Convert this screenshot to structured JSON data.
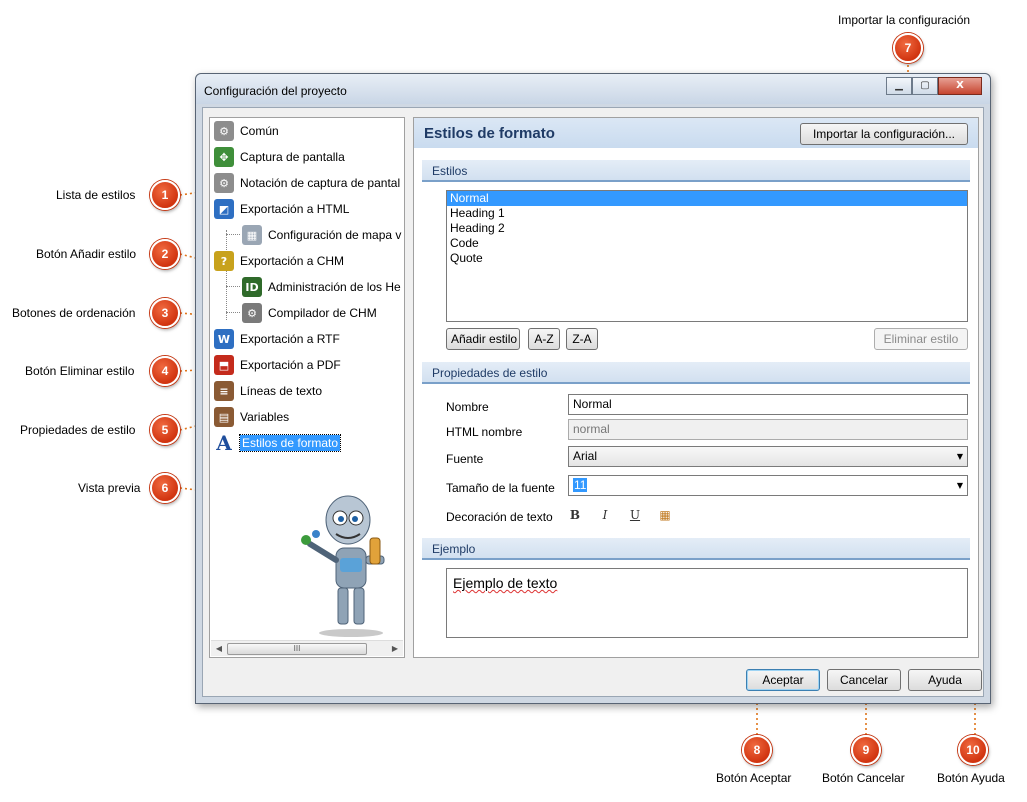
{
  "window": {
    "title": "Configuración del proyecto",
    "controls": {
      "minimize": "▁",
      "maximize": "▢",
      "close": "X"
    }
  },
  "tree": {
    "items": [
      {
        "label": "Común",
        "icon": "gear-icon",
        "color": "#8d8d8d",
        "glyph": "⚙"
      },
      {
        "label": "Captura de pantalla",
        "icon": "screen-capture-icon",
        "color": "#3f8f3a",
        "glyph": "✥"
      },
      {
        "label": "Notación de captura de pantal",
        "icon": "annotation-gear-icon",
        "color": "#8d8d8d",
        "glyph": "⚙"
      },
      {
        "label": "Exportación a HTML",
        "icon": "html-export-icon",
        "color": "#2e6fc2",
        "glyph": "◩"
      },
      {
        "label": "Configuración de mapa v",
        "icon": "sitemap-icon",
        "color": "#9aa6b4",
        "glyph": "▦"
      },
      {
        "label": "Exportación a CHM",
        "icon": "chm-export-icon",
        "color": "#c8a21c",
        "glyph": "?"
      },
      {
        "label": "Administración de los He",
        "icon": "id-icon",
        "color": "#2f6a2a",
        "glyph": "ID"
      },
      {
        "label": "Compilador de CHM",
        "icon": "compiler-icon",
        "color": "#7a7a7a",
        "glyph": "⚙"
      },
      {
        "label": "Exportación a RTF",
        "icon": "rtf-export-icon",
        "color": "#2e6fc2",
        "glyph": "W"
      },
      {
        "label": "Exportación a PDF",
        "icon": "pdf-export-icon",
        "color": "#c42b1c",
        "glyph": "⬒"
      },
      {
        "label": "Líneas de texto",
        "icon": "text-lines-icon",
        "color": "#8a5a34",
        "glyph": "≡"
      },
      {
        "label": "Variables",
        "icon": "variables-icon",
        "color": "#8a5a34",
        "glyph": "▤"
      },
      {
        "label": "Estilos de formato",
        "icon": "font-style-icon",
        "color": "#1f4e9c",
        "glyph": "A"
      }
    ],
    "scroll_grip": "III",
    "scroll_left": "◀",
    "scroll_right": "▶"
  },
  "panel": {
    "title": "Estilos de formato",
    "import_button": "Importar la configuración...",
    "styles_section": "Estilos",
    "styles": [
      "Normal",
      "Heading 1",
      "Heading 2",
      "Code",
      "Quote"
    ],
    "selected_style_index": 0,
    "add_style_button": "Añadir estilo",
    "sort_az_button": "A-Z",
    "sort_za_button": "Z-A",
    "delete_style_button": "Eliminar estilo",
    "properties_section": "Propiedades de estilo",
    "props": {
      "name_label": "Nombre",
      "name_value": "Normal",
      "html_label": "HTML nombre",
      "html_value": "normal",
      "font_label": "Fuente",
      "font_value": "Arial",
      "size_label": "Tamaño de la fuente",
      "size_value": "11",
      "decoration_label": "Decoración de texto",
      "bold": "B",
      "italic": "I",
      "underline": "U",
      "color_grid": "▦"
    },
    "example_section": "Ejemplo",
    "example_text": "Ejemplo de texto"
  },
  "footer": {
    "ok_button": "Aceptar",
    "cancel_button": "Cancelar",
    "help_button": "Ayuda"
  },
  "callouts": [
    {
      "n": "1",
      "label": "Lista de estilos"
    },
    {
      "n": "2",
      "label": "Botón Añadir estilo"
    },
    {
      "n": "3",
      "label": "Botones de ordenación"
    },
    {
      "n": "4",
      "label": "Botón Eliminar estilo"
    },
    {
      "n": "5",
      "label": "Propiedades de estilo"
    },
    {
      "n": "6",
      "label": "Vista previa"
    },
    {
      "n": "7",
      "label": "Importar la configuración"
    },
    {
      "n": "8",
      "label": "Botón Aceptar"
    },
    {
      "n": "9",
      "label": "Botón Cancelar"
    },
    {
      "n": "10",
      "label": "Botón Ayuda"
    }
  ],
  "colors": {
    "accent": "#3399ff",
    "header_text": "#1f3b66",
    "badge": "#e04a1e",
    "callout_line": "#e0761c"
  }
}
